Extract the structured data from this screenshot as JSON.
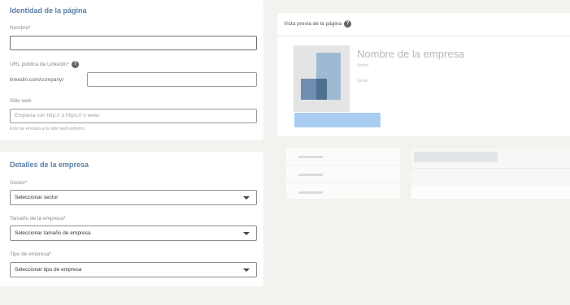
{
  "identity": {
    "title": "Identidad de la página",
    "name_label": "Nombre*",
    "name_value": "",
    "url_label": "URL pública de LinkedIn*",
    "url_help_icon": "help-icon",
    "url_prefix": "linkedin.com/company/",
    "url_value": "",
    "website_label": "Sitio web",
    "website_placeholder": "Empieza con http:// o https:// o www.",
    "website_hint": "Esto se enviará a tu sitio web externo."
  },
  "details": {
    "title": "Detalles de la empresa",
    "sector_label": "Sector*",
    "sector_value": "Seleccionar sector",
    "size_label": "Tamaño de la empresa*",
    "size_value": "Seleccionar tamaño de empresa",
    "type_label": "Tipo de empresa*",
    "type_value": "Seleccionar tipo de empresa",
    "caret_icon": "caret-down-icon"
  },
  "preview": {
    "title": "Vista previa de la página",
    "help_icon": "help-icon",
    "company_name": "Nombre de la empresa",
    "sector": "Sector",
    "tagline": "Lema"
  },
  "colors": {
    "accent_title": "#5a7fa6",
    "button_fill": "#a9cdf0",
    "background": "#f3f2ef"
  }
}
